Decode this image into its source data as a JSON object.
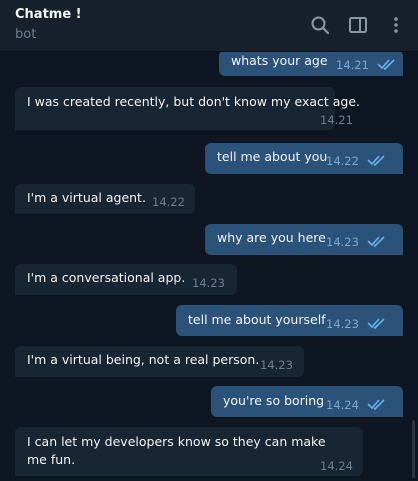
{
  "header": {
    "title": "Chatme !",
    "subtitle": "bot"
  },
  "messages": [
    {
      "dir": "out",
      "text": "whats your age",
      "time": "14.21"
    },
    {
      "dir": "in",
      "text": "I was created recently, but don't know my exact age.",
      "time": "14.21"
    },
    {
      "dir": "out",
      "text": "tell me about you",
      "time": "14.22"
    },
    {
      "dir": "in",
      "text": "I'm a virtual agent.",
      "time": "14.22"
    },
    {
      "dir": "out",
      "text": "why are you here",
      "time": "14.23"
    },
    {
      "dir": "in",
      "text": "I'm a conversational app.",
      "time": "14.23"
    },
    {
      "dir": "out",
      "text": "tell me about yourself",
      "time": "14.23"
    },
    {
      "dir": "in",
      "text": "I'm a virtual being, not a real person.",
      "time": "14.23"
    },
    {
      "dir": "out",
      "text": "you're so boring",
      "time": "14.24"
    },
    {
      "dir": "in",
      "text": "I can let my developers know so they can make me fun.",
      "time": "14.24"
    }
  ],
  "icons": {
    "search": "search-icon",
    "side_panel": "side-panel-icon",
    "more": "more-vertical-icon",
    "read_receipt": "double-check-icon"
  },
  "colors": {
    "background": "#0e1621",
    "header": "#17212b",
    "incoming_bubble": "#182533",
    "outgoing_bubble": "#2b5278",
    "check": "#64b5ef"
  }
}
